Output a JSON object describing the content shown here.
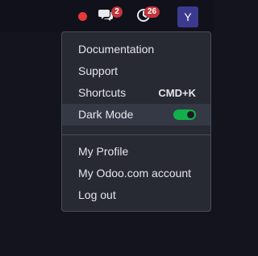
{
  "topbar": {
    "status_dot_color": "#e63a3a",
    "messages": {
      "icon": "chat-bubbles-icon",
      "count": "2"
    },
    "activities": {
      "icon": "clock-icon",
      "count": "26"
    },
    "avatar": {
      "letter": "Y",
      "color": "#3c3a8f"
    }
  },
  "menu": {
    "items": [
      {
        "label": "Documentation"
      },
      {
        "label": "Support"
      },
      {
        "label": "Shortcuts",
        "shortcut": "CMD+K"
      },
      {
        "label": "Dark Mode",
        "toggle_on": true,
        "toggle_color": "#10b04a"
      },
      {
        "label": "My Profile"
      },
      {
        "label": "My Odoo.com account"
      },
      {
        "label": "Log out"
      }
    ]
  }
}
